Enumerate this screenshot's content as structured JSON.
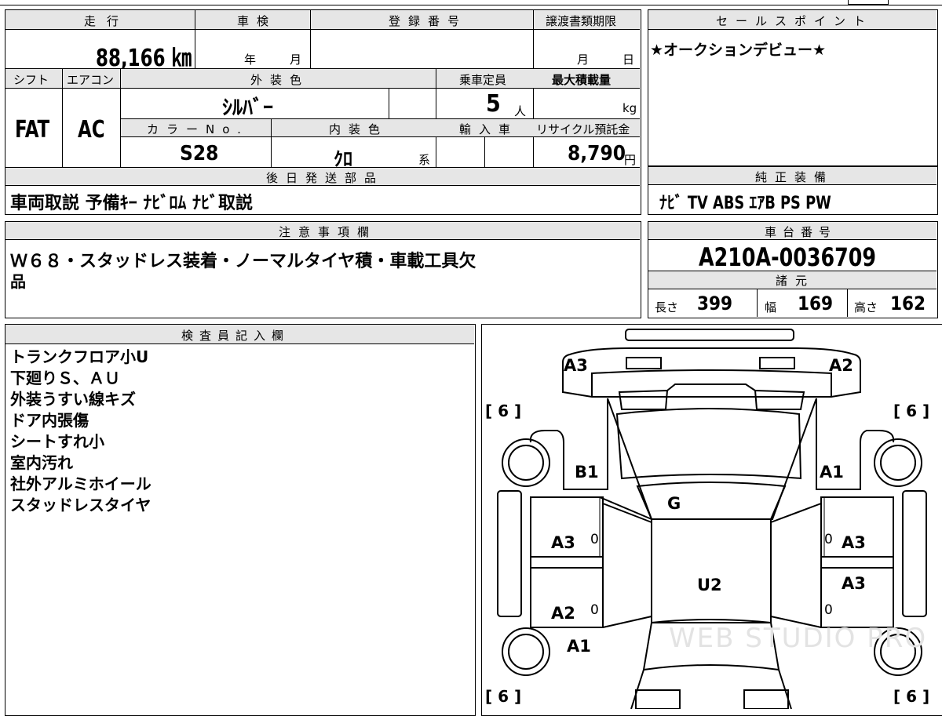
{
  "main_table": {
    "mileage_label": "走行",
    "mileage_value": "88,166 ㎞",
    "shaken_label": "車検",
    "shaken_year": "年",
    "shaken_month": "月",
    "reg_number_label": "登録番号",
    "transfer_deadline_label": "譲渡書類期限",
    "transfer_month": "月",
    "transfer_day": "日",
    "shift_label": "シフト",
    "shift_value": "FAT",
    "aircon_label": "エアコン",
    "aircon_value": "AC",
    "exterior_color_label": "外装色",
    "exterior_color_value": "ｼﾙﾊﾞｰ",
    "capacity_label": "乗車定員",
    "capacity_value": "5",
    "capacity_unit": "人",
    "max_load_label": "最大積載量",
    "max_load_unit": "kg",
    "color_no_label": "カラーNo.",
    "color_no_value": "S28",
    "interior_color_label": "内装色",
    "interior_color_value": "ｸﾛ",
    "interior_color_suffix": "系",
    "import_label": "輸入車",
    "recycle_label": "リサイクル預託金",
    "recycle_value": "8,790",
    "recycle_unit": "円",
    "later_parts_label": "後日発送部品",
    "later_parts_value": "車両取説 予備ｷｰ ﾅﾋﾞﾛﾑ ﾅﾋﾞ取説"
  },
  "sales_point": {
    "label": "セールスポイント",
    "value": "★オークションデビュー★"
  },
  "genuine_equipment": {
    "label": "純正装備",
    "value": "ﾅﾋﾞ TV ABS ｴｱB PS PW"
  },
  "notes": {
    "label": "注意事項欄",
    "line1": "Ｗ６８・スタッドレス装着・ノーマルタイヤ積・車載工具欠",
    "line2": "品"
  },
  "chassis": {
    "label": "車台番号",
    "value": "A210A-0036709"
  },
  "specs": {
    "label": "諸元",
    "length_label": "長さ",
    "length_value": "399",
    "width_label": "幅",
    "width_value": "169",
    "height_label": "高さ",
    "height_value": "162"
  },
  "inspector": {
    "label": "検査員記入欄",
    "lines": [
      "トランクフロア小U",
      "下廻りＳ、ＡＵ",
      "外装うすい線キズ",
      "ドア内張傷",
      "シートすれ小",
      "室内汚れ",
      "社外アルミホイール",
      "スタッドレスタイヤ"
    ]
  },
  "diagram": {
    "marks": {
      "rear_left": "A3",
      "rear_right": "A2",
      "rear_quarter_left": "B1",
      "rear_quarter_right": "A1",
      "roof": "G",
      "rear_door_left": "A3",
      "rear_door_right": "A3",
      "front_door_right": "A3",
      "hood": "U2",
      "front_door_left": "A2",
      "front_fender_left": "A1"
    },
    "tread_marks": [
      "[ 6 ]",
      "[ 6 ]",
      "[ 6 ]",
      "[ 6 ]"
    ],
    "zero_marks": [
      "0",
      "0",
      "0",
      "0"
    ]
  },
  "watermark": "WEB STUDIO PRO"
}
